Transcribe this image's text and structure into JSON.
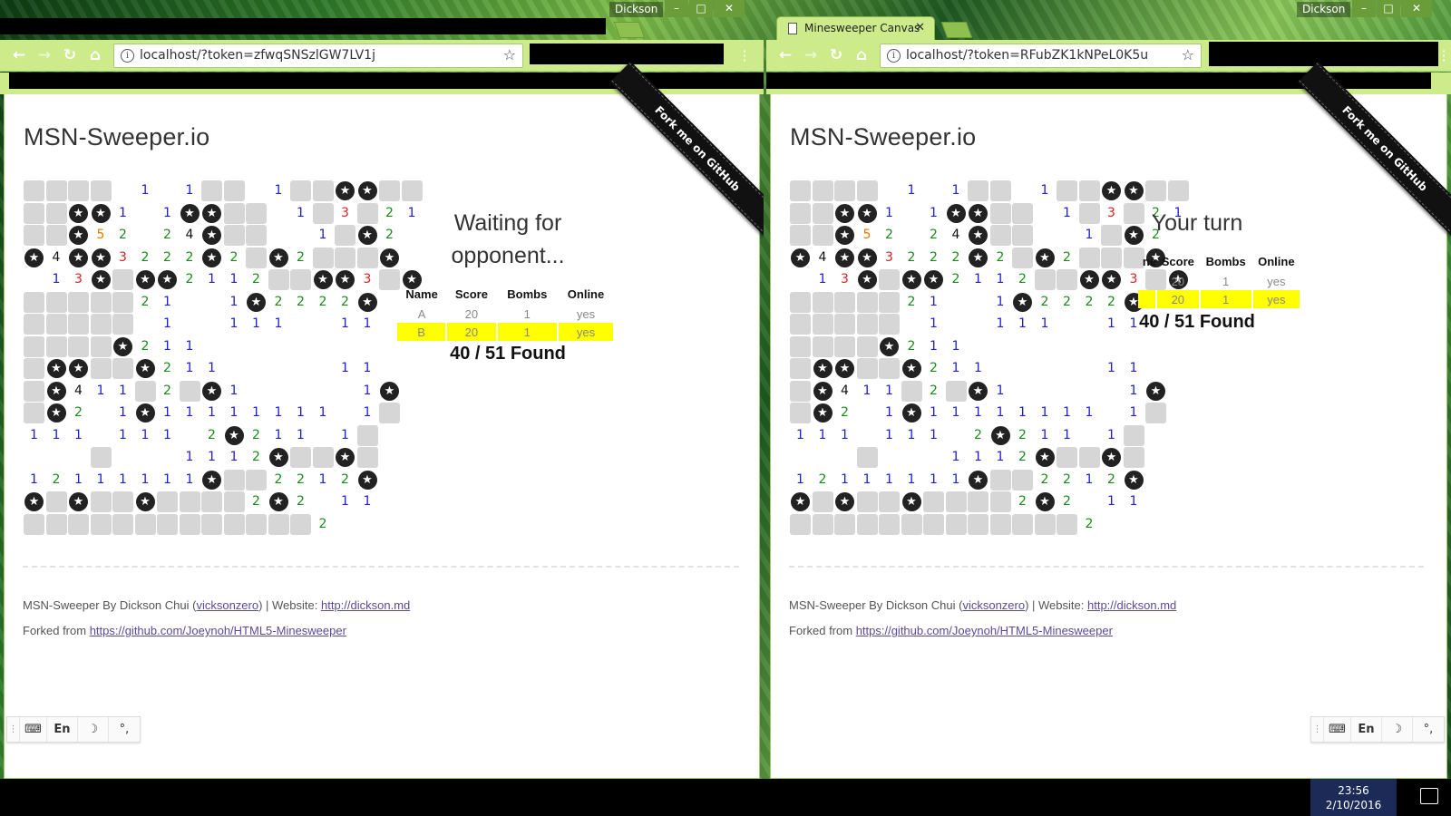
{
  "os": {
    "user": "Dickson",
    "time": "23:56",
    "date": "2/10/2016"
  },
  "window_controls": {
    "minimize": "–",
    "maximize": "□",
    "close": "✕"
  },
  "left_window": {
    "url": "localhost/?token=zfwqSNSzlGW7LV1j",
    "status_line1": "Waiting for",
    "status_line2": "opponent...",
    "found": "40 / 51 Found"
  },
  "right_window": {
    "tab_title": "Minesweeper Canvas",
    "url": "localhost/?token=RFubZK1kNPeL0K5u",
    "status_line1": "Your turn",
    "status_line2": "",
    "found": "40 / 51 Found"
  },
  "page": {
    "title": "MSN-Sweeper.io",
    "ribbon": "Fork me on GitHub",
    "footer_prefix": "MSN-Sweeper By Dickson Chui (",
    "footer_author_link": "vicksonzero",
    "footer_mid": ") | Website: ",
    "footer_site_link": "http://dickson.md",
    "footer_fork_prefix": "Forked from ",
    "footer_fork_link": "https://github.com/Joeynoh/HTML5-Minesweeper"
  },
  "scoreboard": {
    "headers": [
      "Name",
      "Score",
      "Bombs",
      "Online"
    ],
    "rows": [
      [
        "A",
        "20",
        "1",
        "yes"
      ],
      [
        "B",
        "20",
        "1",
        "yes"
      ]
    ],
    "highlight_color": "#ffff00"
  },
  "ime": {
    "keyboard": "⌨",
    "lang": "En",
    "moon": "☽",
    "punct": "°,"
  },
  "board": {
    "legend": "# = covered, * = found mine, . = empty, digit = count",
    "rows": [
      "####.1.1##.1##**##",
      "##**1.1**##.1#3#21",
      "##*52.24*##..1#*2.",
      "*4**3222*2#*2###*.",
      ".13*#**2112##**3#*",
      "#####21..1*2222*",
      "#####.1..111..11",
      "####*211........",
      "#**##*211.....11",
      "#*411#2#*1.....1*",
      "#*2.1*11111111.1#",
      "111.111.2*211.1#",
      "...#...1112*##*#",
      "12111111*##2212*",
      "*#*##*####2*2.11",
      "#############2"
    ]
  },
  "colors": {
    "chrome": "#cdeb8b",
    "accent": "#ffff00",
    "mine": "#222222",
    "covered": "#d6d6d6"
  }
}
